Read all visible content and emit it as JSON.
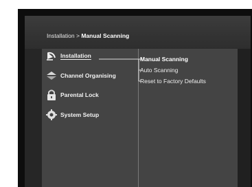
{
  "breadcrumb": {
    "path": "Installation > ",
    "current": "Manual Scanning"
  },
  "main_menu": {
    "items": [
      {
        "label": "Installation",
        "icon": "satellite-dish-icon",
        "selected": true
      },
      {
        "label": "Channel Organising",
        "icon": "sort-arrows-icon",
        "selected": false
      },
      {
        "label": "Parental Lock",
        "icon": "padlock-icon",
        "selected": false
      },
      {
        "label": "System Setup",
        "icon": "gear-icon",
        "selected": false
      }
    ]
  },
  "sub_menu": {
    "items": [
      {
        "label": "Manual Scanning",
        "selected": true
      },
      {
        "label": "Auto Scanning",
        "selected": false
      },
      {
        "label": "Reset to Factory Defaults",
        "selected": false
      }
    ]
  },
  "colors": {
    "frame": "#0d0d0d",
    "panel": "#444444",
    "text": "#f2f2f2"
  }
}
